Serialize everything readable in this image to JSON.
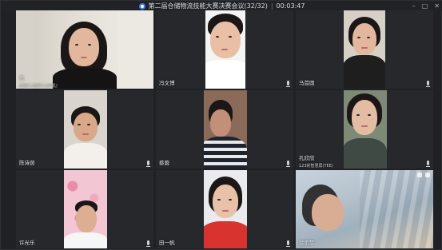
{
  "window": {
    "title": "第二届仓储物流技能大赛决赛会议(32/32)",
    "separator": "|",
    "timer": "00:03:47",
    "controls": {
      "minimize": "–",
      "maximize": "□",
      "close": "✕"
    }
  },
  "participants": [
    {
      "name": "熊",
      "subtitle": "主持人(主持人)(本机)"
    },
    {
      "name": "冯文博",
      "subtitle": ""
    },
    {
      "name": "马首圆",
      "subtitle": ""
    },
    {
      "name": "陈诗茵",
      "subtitle": ""
    },
    {
      "name": "蔡蓉",
      "subtitle": ""
    },
    {
      "name": "孔欣欣",
      "subtitle": "123的智慧屏(TEE)"
    },
    {
      "name": "许光乐",
      "subtitle": ""
    },
    {
      "name": "田一帆",
      "subtitle": ""
    },
    {
      "name": "徐雨梦",
      "subtitle": ""
    }
  ],
  "colors": {
    "window_bg": "#1f2124",
    "tile_bg": "#26282c",
    "accent": "#3b7cf5"
  }
}
